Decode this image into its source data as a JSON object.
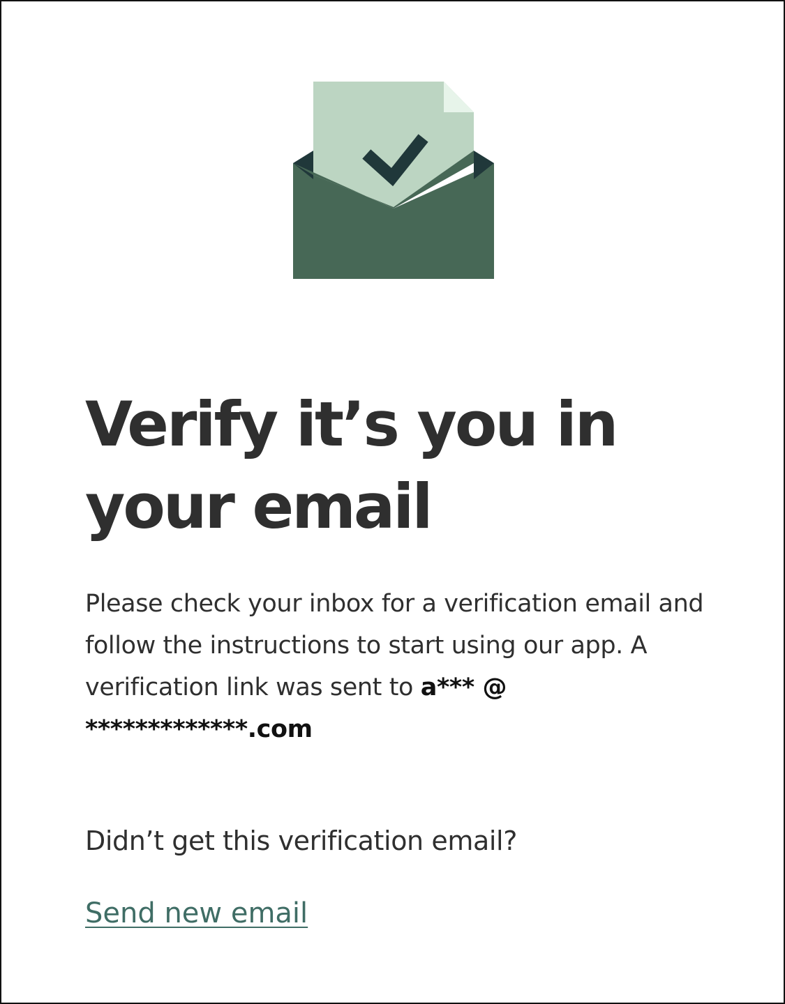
{
  "illustration": {
    "icon": "envelope-check-icon",
    "colors": {
      "envelope": "#476856",
      "envelope_inside": "#20383a",
      "letter": "#bcd5c2",
      "letter_fold": "#e7f4ea",
      "check": "#20383a"
    }
  },
  "page": {
    "title": "Verify it’s you in your email",
    "message": "Please check your inbox for a verification email and follow the instructions to start using our app. A verification link was sent to",
    "masked_email": "a*** @ *************.com",
    "question": "Didn’t get this verification email?",
    "resend_link": "Send new email"
  },
  "colors": {
    "text": "#2f2f2f",
    "link": "#3f6d65",
    "background": "#ffffff"
  }
}
